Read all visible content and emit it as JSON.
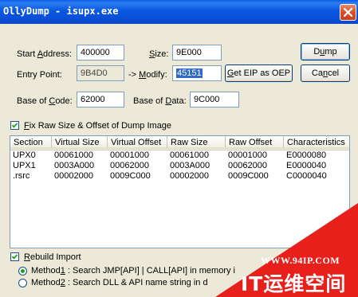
{
  "window": {
    "title": "OllyDump - isupx.exe"
  },
  "fields": {
    "start_address": {
      "label_pre": "Start ",
      "label_u": "A",
      "label_post": "ddress:",
      "value": "400000"
    },
    "size": {
      "label_u": "S",
      "label_post": "ize:",
      "value": "9E000"
    },
    "entry_point": {
      "label": "Entry Point:",
      "value": "9B4D0"
    },
    "modify": {
      "label_pre": "-> ",
      "label_u": "M",
      "label_post": "odify:",
      "value": "45151"
    },
    "base_of_code": {
      "label_pre": "Base of ",
      "label_u": "C",
      "label_post": "ode:",
      "value": "62000"
    },
    "base_of_data": {
      "label_pre": "Base of ",
      "label_u": "D",
      "label_post": "ata:",
      "value": "9C000"
    }
  },
  "buttons": {
    "dump": {
      "pre": "D",
      "u": "u",
      "post": "mp"
    },
    "cancel": {
      "pre": "Ca",
      "u": "n",
      "post": "cel"
    },
    "get_eip": {
      "pre": "",
      "u": "G",
      "post": "et EIP as OEP"
    }
  },
  "fix_raw": {
    "u": "F",
    "post": "ix Raw Size & Offset of Dump Image",
    "checked": true
  },
  "sections_table": {
    "columns": [
      "Section",
      "Virtual Size",
      "Virtual Offset",
      "Raw Size",
      "Raw Offset",
      "Characteristics"
    ],
    "rows": [
      [
        "UPX0",
        "00061000",
        "00001000",
        "00061000",
        "00001000",
        "E0000080"
      ],
      [
        "UPX1",
        "0003A000",
        "00062000",
        "0003A000",
        "00062000",
        "E0000040"
      ],
      [
        ".rsrc",
        "00002000",
        "0009C000",
        "00002000",
        "0009C000",
        "C0000040"
      ]
    ]
  },
  "rebuild_import": {
    "u": "R",
    "post": "ebuild Import",
    "checked": true
  },
  "methods": [
    {
      "pre": "Method",
      "u": "1",
      "post": " : Search JMP[API] | CALL[API] in memory i",
      "selected": true
    },
    {
      "pre": "Method",
      "u": "2",
      "post": " : Search DLL & API name string in d",
      "selected": false
    }
  ],
  "watermark": {
    "url": "WWW.94IP.COM",
    "brand": "IT运维空间",
    "color": "#e8201c"
  }
}
